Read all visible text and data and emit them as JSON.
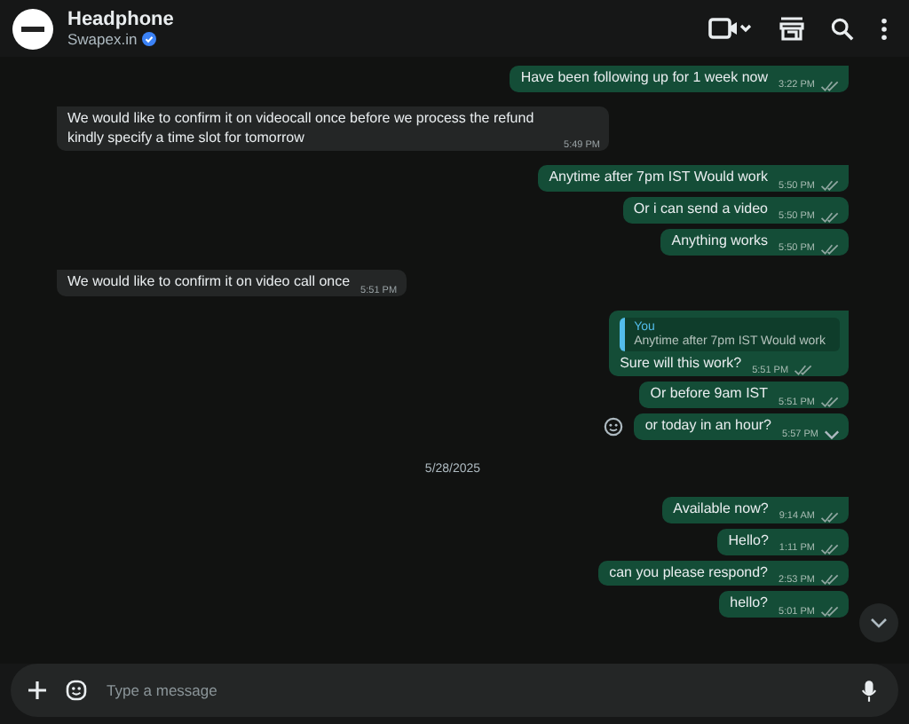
{
  "header": {
    "name": "Headphone",
    "subtitle": "Swapex.in",
    "verified": true
  },
  "messages": [
    {
      "kind": "out",
      "text": "Have been following up for 1 week now",
      "time": "3:22 PM",
      "tail": true,
      "hovered": false
    },
    {
      "kind": "in",
      "text": "We would like to confirm it on videocall once before we process the refund kindly specify a time slot for tomorrow",
      "time": "5:49 PM",
      "tail": true,
      "hovered": false
    },
    {
      "kind": "out",
      "text": "Anytime after 7pm IST Would work",
      "time": "5:50 PM",
      "tail": true,
      "hovered": false
    },
    {
      "kind": "out",
      "text": "Or i can send a video",
      "time": "5:50 PM",
      "tail": false,
      "hovered": false
    },
    {
      "kind": "out",
      "text": "Anything works",
      "time": "5:50 PM",
      "tail": false,
      "hovered": false
    },
    {
      "kind": "in",
      "text": "We would like to confirm it on video call once",
      "time": "5:51 PM",
      "tail": true,
      "hovered": false
    },
    {
      "kind": "out",
      "text": "Sure will this work?",
      "time": "5:51 PM",
      "tail": true,
      "hovered": false,
      "quote": {
        "author": "You",
        "text": "Anytime after 7pm IST Would work"
      }
    },
    {
      "kind": "out",
      "text": "Or before 9am IST",
      "time": "5:51 PM",
      "tail": false,
      "hovered": false
    },
    {
      "kind": "out",
      "text": "or today in an hour?",
      "time": "5:57 PM",
      "tail": false,
      "hovered": true
    },
    {
      "kind": "date",
      "text": "5/28/2025"
    },
    {
      "kind": "out",
      "text": "Available now?",
      "time": "9:14 AM",
      "tail": true,
      "hovered": false
    },
    {
      "kind": "out",
      "text": "Hello?",
      "time": "1:11 PM",
      "tail": false,
      "hovered": false
    },
    {
      "kind": "out",
      "text": "can you please respond?",
      "time": "2:53 PM",
      "tail": false,
      "hovered": false
    },
    {
      "kind": "out",
      "text": "hello?",
      "time": "5:01 PM",
      "tail": false,
      "hovered": false
    }
  ],
  "composer": {
    "placeholder": "Type a message"
  }
}
